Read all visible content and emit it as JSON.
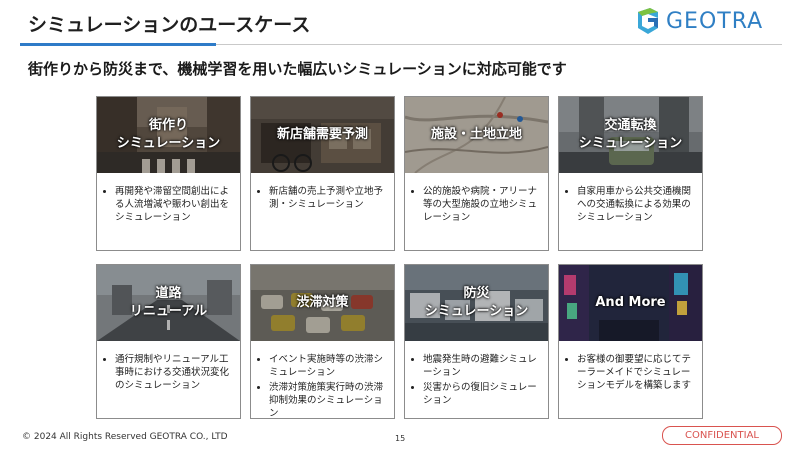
{
  "header": {
    "title": "シミュレーションのユースケース",
    "logo_text": "GEOTRA"
  },
  "subtitle": "街作りから防災まで、機械学習を用いた幅広いシミュレーションに対応可能です",
  "cards": [
    {
      "label": "街作り\nシミュレーション",
      "items": [
        "再開発や滞留空間創出による人流増減や賑わい創出をシミュレーション"
      ]
    },
    {
      "label": "新店舗需要予測",
      "items": [
        "新店舗の売上予測や立地予測・シミュレーション"
      ]
    },
    {
      "label": "施設・土地立地",
      "items": [
        "公的施設や病院・アリーナ等の大型施設の立地シミュレーション"
      ]
    },
    {
      "label": "交通転換\nシミュレーション",
      "items": [
        "自家用車から公共交通機関への交通転換による効果のシミュレーション"
      ]
    },
    {
      "label": "道路\nリニューアル",
      "items": [
        "通行規制やリニューアル工事時における交通状況変化のシミュレーション"
      ]
    },
    {
      "label": "渋滞対策",
      "items": [
        "イベント実施時等の渋滞シミュレーション",
        "渋滞対策施策実行時の渋滞抑制効果のシミュレーション"
      ]
    },
    {
      "label": "防災\nシミュレーション",
      "items": [
        "地震発生時の避難シミュレーション",
        "災害からの復旧シミュレーション"
      ]
    },
    {
      "label": "And More",
      "items": [
        "お客様の御要望に応じてテーラーメイドでシミュレーションモデルを構築します"
      ]
    }
  ],
  "footer": {
    "copyright": "© 2024 All Rights Reserved GEOTRA CO., LTD",
    "page_number": "15",
    "confidential": "CONFIDENTIAL"
  }
}
